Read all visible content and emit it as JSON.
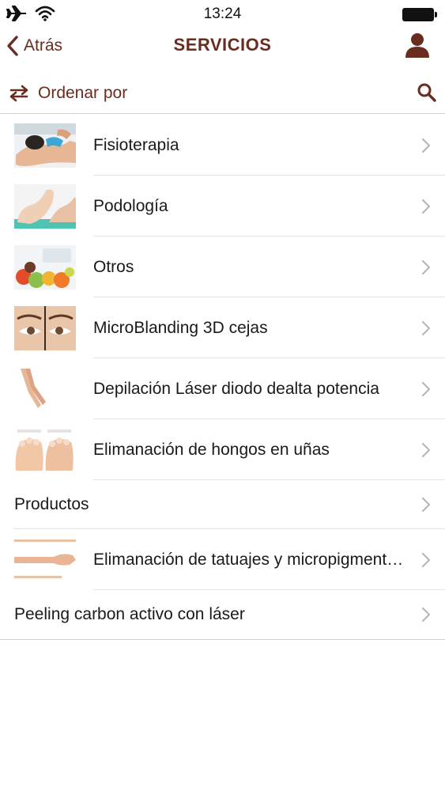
{
  "status_bar": {
    "time": "13:24",
    "icons": [
      "airplane-icon",
      "wifi-icon",
      "battery-icon"
    ]
  },
  "nav": {
    "back_label": "Atrás",
    "title": "SERVICIOS",
    "right_icon": "person-icon"
  },
  "sort": {
    "label": "Ordenar por",
    "icon": "sort-arrows-icon",
    "search_icon": "search-icon"
  },
  "colors": {
    "accent": "#6a2c1f",
    "text": "#1a1a1a",
    "separator": "#e3e3e3",
    "chevron": "#b8b8b8"
  },
  "services": [
    {
      "label": "Fisioterapia",
      "thumbnail": "physiotherapy-photo"
    },
    {
      "label": "Podología",
      "thumbnail": "feet-photo"
    },
    {
      "label": "Otros",
      "thumbnail": "fruits-photo"
    },
    {
      "label": "MicroBlanding 3D cejas",
      "thumbnail": "eyebrows-photo"
    },
    {
      "label": "Depilación Láser diodo dealta potencia",
      "thumbnail": "legs-photo"
    },
    {
      "label": "Elimanación de hongos en uñas",
      "thumbnail": "toenails-photo"
    },
    {
      "label": "Productos",
      "thumbnail": null
    },
    {
      "label": "Elimanación de tatuajes y micropigmentación",
      "thumbnail": "arm-photo"
    },
    {
      "label": "Peeling carbon activo con láser",
      "thumbnail": null
    }
  ]
}
